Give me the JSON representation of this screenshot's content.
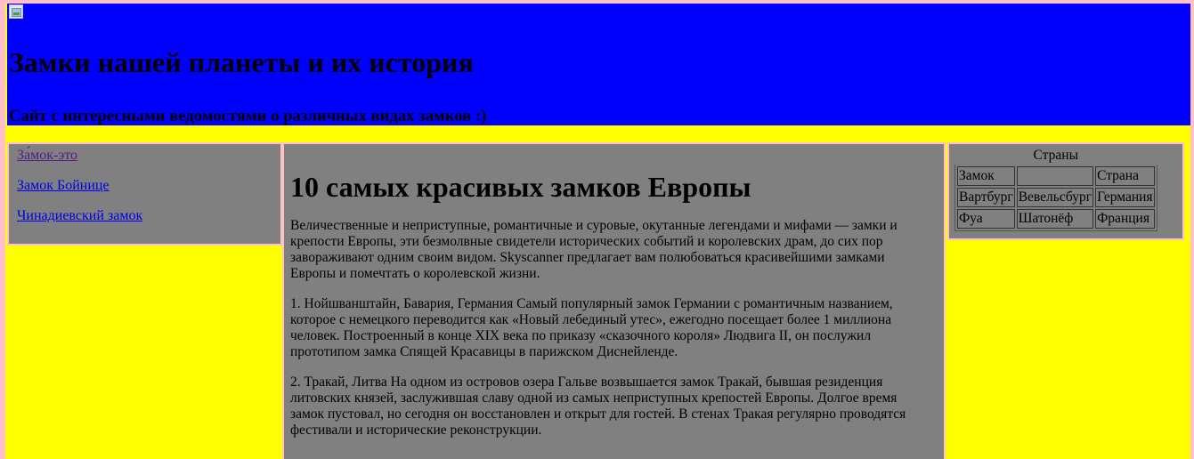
{
  "header": {
    "logo_icon": "broken-image-icon",
    "title": "Замки нашей планеты и их история",
    "subtitle": "Сайт с интересными ведомостями о различных видах замков :)"
  },
  "nav": {
    "links": [
      {
        "label": "За́мок-это",
        "visited": true
      },
      {
        "label": "Замок Бойнице",
        "visited": false
      },
      {
        "label": "Чинадиевский замок",
        "visited": false
      }
    ]
  },
  "main": {
    "title": "10 самых красивых замков Европы",
    "paragraphs": [
      "Величественные и неприступные, романтичные и суровые, окутанные легендами и мифами — замки и крепости Европы, эти безмолвные свидетели исторических событий и королевских драм, до сих пор завораживают одним своим видом. Skyscanner предлагает вам полюбоваться красивейшими замками Европы и помечтать о королевской жизни.",
      "1. Нойшванштайн, Бавария, Германия Самый популярный замок Германии с романтичным названием, которое с немецкого переводится как «Новый лебединый утес», ежегодно посещает более 1 миллиона человек. Построенный в конце XIX века по приказу «сказочного короля» Людвига II, он послужил прототипом замка Спящей Красавицы в парижском Диснейленде.",
      "2. Тракай, Литва На одном из островов озера Гальве возвышается замок Тракай, бывшая резиденция литовских князей, заслужившая славу одной из самых неприступных крепостей Европы. Долгое время замок пустовал, но сегодня он восстановлен и открыт для гостей. В стенах Тракая регулярно проводятся фестивали и исторические реконструкции."
    ]
  },
  "aside": {
    "caption": "Страны",
    "rows": [
      [
        "Замок",
        "",
        "Страна"
      ],
      [
        "Вартбург",
        "Вевельсбург",
        "Германия"
      ],
      [
        "Фуа",
        "Шатонёф",
        "Франция"
      ]
    ]
  },
  "colors": {
    "page_border": "#ffc0cb",
    "page_background": "#ffff00",
    "header_background": "#0000ff",
    "panel_background": "#808080"
  }
}
